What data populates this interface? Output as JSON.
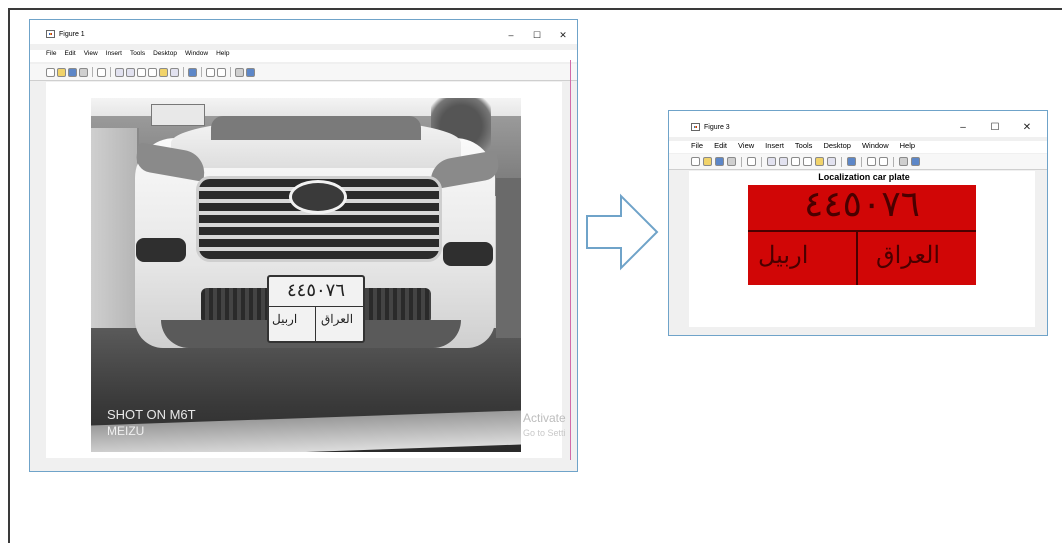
{
  "figure1": {
    "title": "Figure 1",
    "controls": {
      "minimize": "–",
      "maximize": "☐",
      "close": "✕"
    },
    "menu": [
      "File",
      "Edit",
      "View",
      "Insert",
      "Tools",
      "Desktop",
      "Window",
      "Help"
    ],
    "photo": {
      "plate_number": "٤٤٥٠٧٦",
      "plate_text_left": "اربيل",
      "plate_text_right": "العراق",
      "watermark_line1": "SHOT ON M6T",
      "watermark_line2": "MEIZU",
      "activate_line1": "Activate",
      "activate_line2": "Go to Setti"
    }
  },
  "figure3": {
    "title": "Figure 3",
    "controls": {
      "minimize": "–",
      "maximize": "☐",
      "close": "✕"
    },
    "menu": [
      "File",
      "Edit",
      "View",
      "Insert",
      "Tools",
      "Desktop",
      "Window",
      "Help"
    ],
    "plot_title": "Localization car plate",
    "plate_number": "٤٤٥٠٧٦",
    "plate_text_left": "اربيل",
    "plate_text_right": "العراق"
  },
  "colors": {
    "window_border": "#6fa3c9",
    "plate_red": "#d10606",
    "arrow": "#6fa3c9"
  },
  "icons": [
    "new-file-icon",
    "open-icon",
    "save-icon",
    "print-icon",
    "pointer-icon",
    "zoom-in-icon",
    "zoom-out-icon",
    "pan-icon",
    "rotate-icon",
    "data-cursor-icon",
    "brush-icon",
    "link-icon",
    "colorbar-icon",
    "legend-icon",
    "grid-icon"
  ]
}
